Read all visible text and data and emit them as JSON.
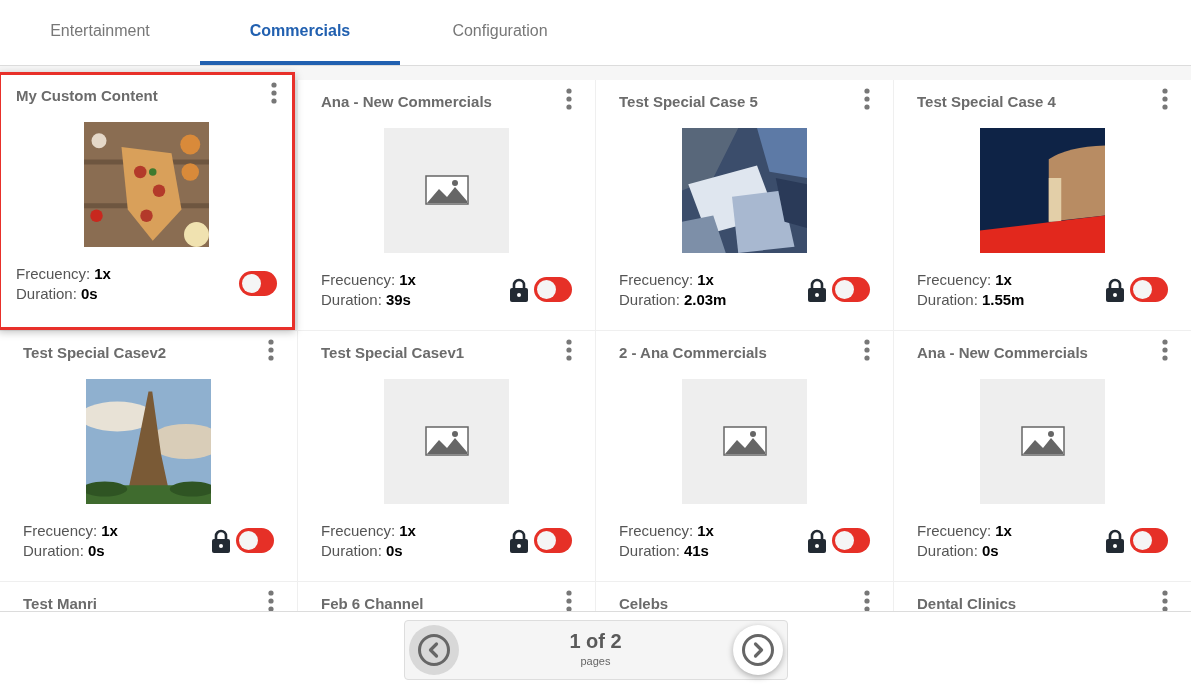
{
  "tabs": [
    {
      "label": "Entertainment",
      "selected": false
    },
    {
      "label": "Commercials",
      "selected": true
    },
    {
      "label": "Configuration",
      "selected": false
    }
  ],
  "cards": [
    {
      "title": "My Custom Content",
      "frequency_label": "Frecuency:",
      "frequency": "1x",
      "duration_label": "Duration:",
      "duration": "0s",
      "locked": false,
      "on": false,
      "selected": true
    },
    {
      "title": "Ana - New Commercials",
      "thumbnail": {
        "kind": "placeholder"
      },
      "frequency_label": "Frecuency:",
      "frequency": "1x",
      "duration_label": "Duration:",
      "duration": "39s",
      "locked": true,
      "on": false,
      "selected": false
    },
    {
      "title": "Test Special Case 5",
      "frequency_label": "Frecuency:",
      "frequency": "1x",
      "duration_label": "Duration:",
      "duration": "2.03m",
      "locked": true,
      "on": false,
      "selected": false
    },
    {
      "title": "Test Special Case 4",
      "frequency_label": "Frecuency:",
      "frequency": "1x",
      "duration_label": "Duration:",
      "duration": "1.55m",
      "locked": true,
      "on": false,
      "selected": false
    },
    {
      "title": "Test Special Casev2",
      "frequency_label": "Frecuency:",
      "frequency": "1x",
      "duration_label": "Duration:",
      "duration": "0s",
      "locked": true,
      "on": false,
      "selected": false
    },
    {
      "title": "Test Special Casev1",
      "thumbnail": {
        "kind": "placeholder"
      },
      "frequency_label": "Frecuency:",
      "frequency": "1x",
      "duration_label": "Duration:",
      "duration": "0s",
      "locked": true,
      "on": false,
      "selected": false
    },
    {
      "title": "2 - Ana Commercials",
      "thumbnail": {
        "kind": "placeholder"
      },
      "frequency_label": "Frecuency:",
      "frequency": "1x",
      "duration_label": "Duration:",
      "duration": "41s",
      "locked": true,
      "on": false,
      "selected": false
    },
    {
      "title": "Ana - New Commercials",
      "thumbnail": {
        "kind": "placeholder"
      },
      "frequency_label": "Frecuency:",
      "frequency": "1x",
      "duration_label": "Duration:",
      "duration": "0s",
      "locked": true,
      "on": false,
      "selected": false
    },
    {
      "title": "Test Manri",
      "selected": false
    },
    {
      "title": "Feb 6 Channel",
      "selected": false
    },
    {
      "title": "Celebs",
      "selected": false
    },
    {
      "title": "Dental Clinics",
      "selected": false
    }
  ],
  "pagination": {
    "current": "1 of 2",
    "caption": "pages"
  }
}
